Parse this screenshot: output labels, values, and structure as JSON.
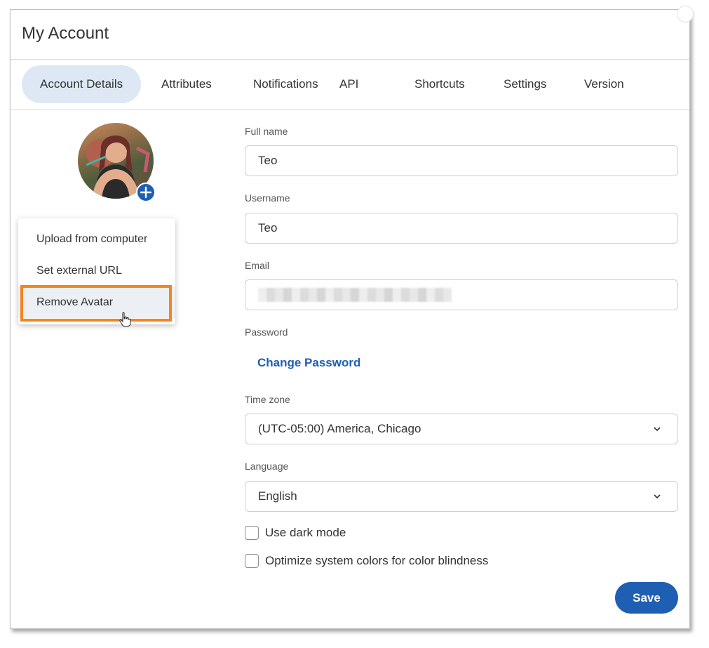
{
  "dialog": {
    "title": "My Account"
  },
  "tabs": [
    {
      "label": "Account Details",
      "active": true
    },
    {
      "label": "Attributes"
    },
    {
      "label": "Notifications"
    },
    {
      "label": "API"
    },
    {
      "label": "Shortcuts"
    },
    {
      "label": "Settings"
    },
    {
      "label": "Version"
    }
  ],
  "avatar_menu": {
    "items": [
      {
        "label": "Upload from computer"
      },
      {
        "label": "Set external URL"
      },
      {
        "label": "Remove Avatar",
        "hovered": true
      }
    ]
  },
  "form": {
    "full_name": {
      "label": "Full name",
      "value": "Teo"
    },
    "username": {
      "label": "Username",
      "value": "Teo"
    },
    "email": {
      "label": "Email"
    },
    "password": {
      "label": "Password",
      "link": "Change Password"
    },
    "time_zone": {
      "label": "Time zone",
      "value": "(UTC-05:00) America, Chicago"
    },
    "language": {
      "label": "Language",
      "value": "English"
    },
    "dark_mode": {
      "label": "Use dark mode",
      "checked": false
    },
    "color_blind": {
      "label": "Optimize system colors for color blindness",
      "checked": false
    },
    "save_label": "Save"
  },
  "colors": {
    "accent": "#1f5fb3",
    "active_tab_bg": "#dde8f4",
    "highlight": "#f5841f"
  }
}
